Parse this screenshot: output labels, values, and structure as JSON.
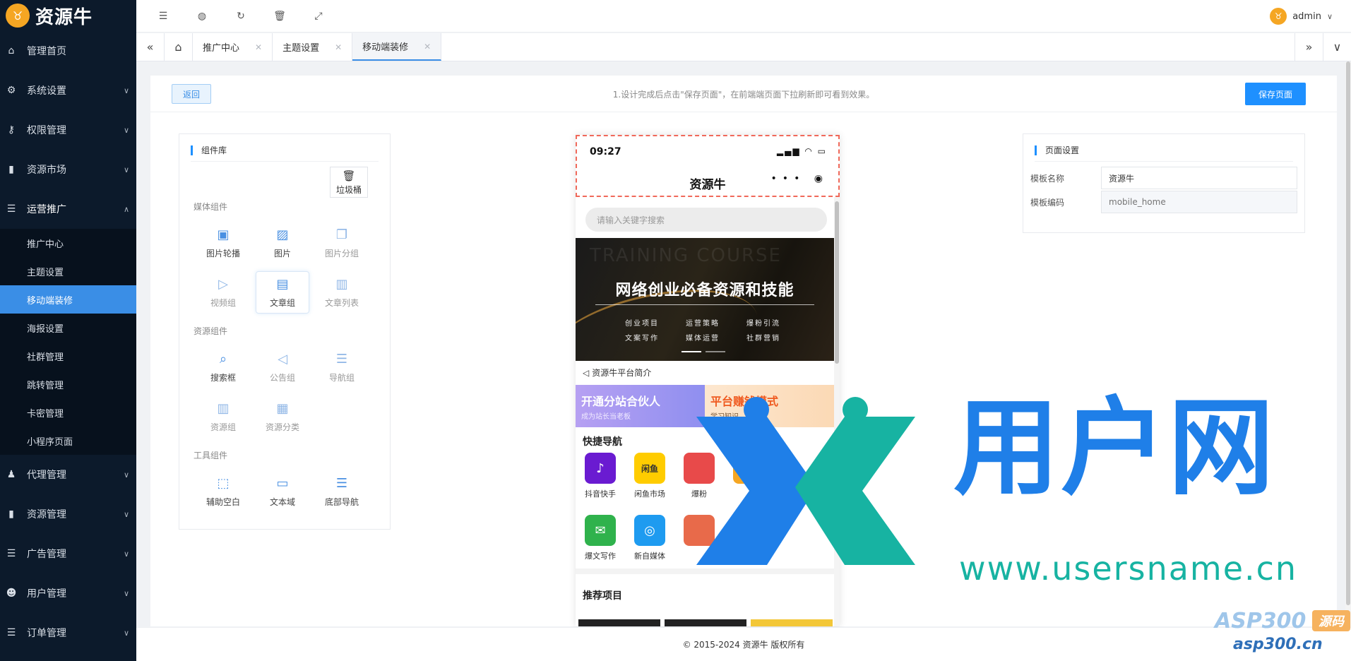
{
  "brand": {
    "name": "资源牛"
  },
  "sidebar": {
    "items": [
      {
        "label": "管理首页",
        "icon": "home-icon"
      },
      {
        "label": "系统设置",
        "icon": "gear-icon"
      },
      {
        "label": "权限管理",
        "icon": "key-icon"
      },
      {
        "label": "资源市场",
        "icon": "folder-icon"
      },
      {
        "label": "运营推广",
        "icon": "list-icon"
      },
      {
        "label": "代理管理",
        "icon": "user-group-icon"
      },
      {
        "label": "资源管理",
        "icon": "file-icon"
      },
      {
        "label": "广告管理",
        "icon": "list-icon"
      },
      {
        "label": "用户管理",
        "icon": "user-icon"
      },
      {
        "label": "订单管理",
        "icon": "list-icon"
      }
    ],
    "submenu": [
      "推广中心",
      "主题设置",
      "移动端装修",
      "海报设置",
      "社群管理",
      "跳转管理",
      "卡密管理",
      "小程序页面"
    ],
    "active_sub": "移动端装修"
  },
  "header": {
    "user": "admin"
  },
  "tabs": [
    "推广中心",
    "主题设置",
    "移动端装修"
  ],
  "toolbar": {
    "back_label": "返回",
    "hint": "1.设计完成后点击\"保存页面\"，在前端端页面下拉刷新即可看到效果。",
    "save_label": "保存页面"
  },
  "components": {
    "title": "组件库",
    "trash_label": "垃圾桶",
    "groups": [
      {
        "title": "媒体组件",
        "items": [
          "图片轮播",
          "图片",
          "图片分组",
          "视频组",
          "文章组",
          "文章列表"
        ]
      },
      {
        "title": "资源组件",
        "items": [
          "搜索框",
          "公告组",
          "导航组",
          "资源组",
          "资源分类"
        ]
      },
      {
        "title": "工具组件",
        "items": [
          "辅助空白",
          "文本域",
          "底部导航"
        ]
      }
    ]
  },
  "phone": {
    "time": "09:27",
    "title": "资源牛",
    "search_placeholder": "请输入关键字搜索",
    "banner_bg": "TRAINING COURSE",
    "banner_title": "网络创业必备资源和技能",
    "banner_tags": [
      "创业项目",
      "运营策略",
      "爆粉引流",
      "文案写作",
      "媒体运营",
      "社群营销"
    ],
    "notice": "资源牛平台简介",
    "promo_a_title": "开通分站合伙人",
    "promo_a_sub": "成为站长当老板",
    "promo_b_title": "平台赚钱模式",
    "promo_b_sub": "学习知识",
    "quick_nav_title": "快捷导航",
    "nav": [
      {
        "label": "抖音快手",
        "color": "#6a1bd1",
        "glyph": "♪"
      },
      {
        "label": "闲鱼市场",
        "color": "#ffcc00",
        "glyph": "闲鱼"
      },
      {
        "label": "爆粉",
        "color": "#e84a4a",
        "glyph": ""
      },
      {
        "label": "",
        "color": "#f5a623",
        "glyph": ""
      },
      {
        "label": "爆文写作",
        "color": "#2fb24c",
        "glyph": "✉"
      },
      {
        "label": "新自媒体",
        "color": "#1e9bf0",
        "glyph": "◎"
      },
      {
        "label": "",
        "color": "#e86a4a",
        "glyph": ""
      },
      {
        "label": "",
        "color": "#f5c623",
        "glyph": ""
      }
    ],
    "recommend_title": "推荐项目"
  },
  "settings": {
    "title": "页面设置",
    "template_name_label": "模板名称",
    "template_name_value": "资源牛",
    "template_code_label": "模板编码",
    "template_code_placeholder": "mobile_home"
  },
  "footer": {
    "copyright": "© 2015-2024 资源牛 版权所有"
  },
  "watermark": {
    "big": "用户网",
    "url": "www.usersname.cn",
    "asp": "ASP300",
    "asp_badge": "源码",
    "asp_url": "asp300.cn"
  }
}
